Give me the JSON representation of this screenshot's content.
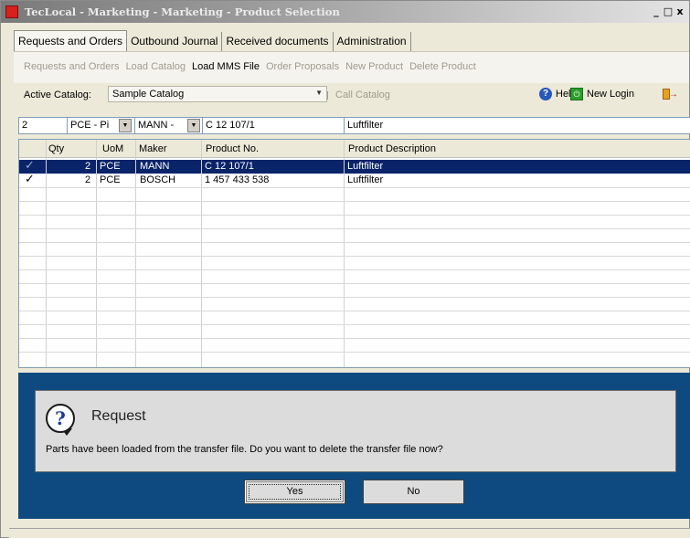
{
  "window": {
    "title": "TecLocal - Marketing - Marketing - Product Selection",
    "controls": {
      "minimize": "_",
      "restore": "□",
      "close": "x"
    }
  },
  "tabs": [
    {
      "label": "Requests and Orders",
      "active": true
    },
    {
      "label": "Outbound Journal"
    },
    {
      "label": "Received documents"
    },
    {
      "label": "Administration"
    }
  ],
  "toolbar": {
    "items": [
      {
        "label": "Requests and Orders",
        "enabled": false
      },
      {
        "label": "Load Catalog",
        "enabled": false
      },
      {
        "label": "Load MMS File",
        "enabled": true
      },
      {
        "label": "Order Proposals",
        "enabled": false
      },
      {
        "label": "New Product",
        "enabled": false
      },
      {
        "label": "Delete Product",
        "enabled": false
      }
    ]
  },
  "catalog": {
    "label": "Active Catalog:",
    "value": "Sample Catalog",
    "call_label": "Call Catalog"
  },
  "right_actions": {
    "help_label": "Help",
    "new_login_label": "New Login"
  },
  "edit_row": {
    "qty": "2",
    "uom": "PCE - Pi",
    "maker": "MANN -",
    "product_no": "C 12 107/1",
    "description": "Luftfilter"
  },
  "grid": {
    "columns": [
      "Qty",
      "UoM",
      "Maker",
      "Product No.",
      "Product Description"
    ],
    "rows": [
      {
        "checked": true,
        "selected": true,
        "qty": "2",
        "uom": "PCE",
        "maker": "MANN",
        "product_no": "C 12 107/1",
        "description": "Luftfilter"
      },
      {
        "checked": true,
        "selected": false,
        "qty": "2",
        "uom": "PCE",
        "maker": "BOSCH",
        "product_no": "1 457 433 538",
        "description": "Luftfilter"
      }
    ]
  },
  "dialog": {
    "title": "Request",
    "message": "Parts have been loaded from the transfer file. Do you want to delete the transfer file now?",
    "yes_label": "Yes",
    "no_label": "No"
  },
  "colors": {
    "selection": "#0a246a",
    "dialog_band": "#0e4a80",
    "window_bg": "#ece9d8"
  }
}
